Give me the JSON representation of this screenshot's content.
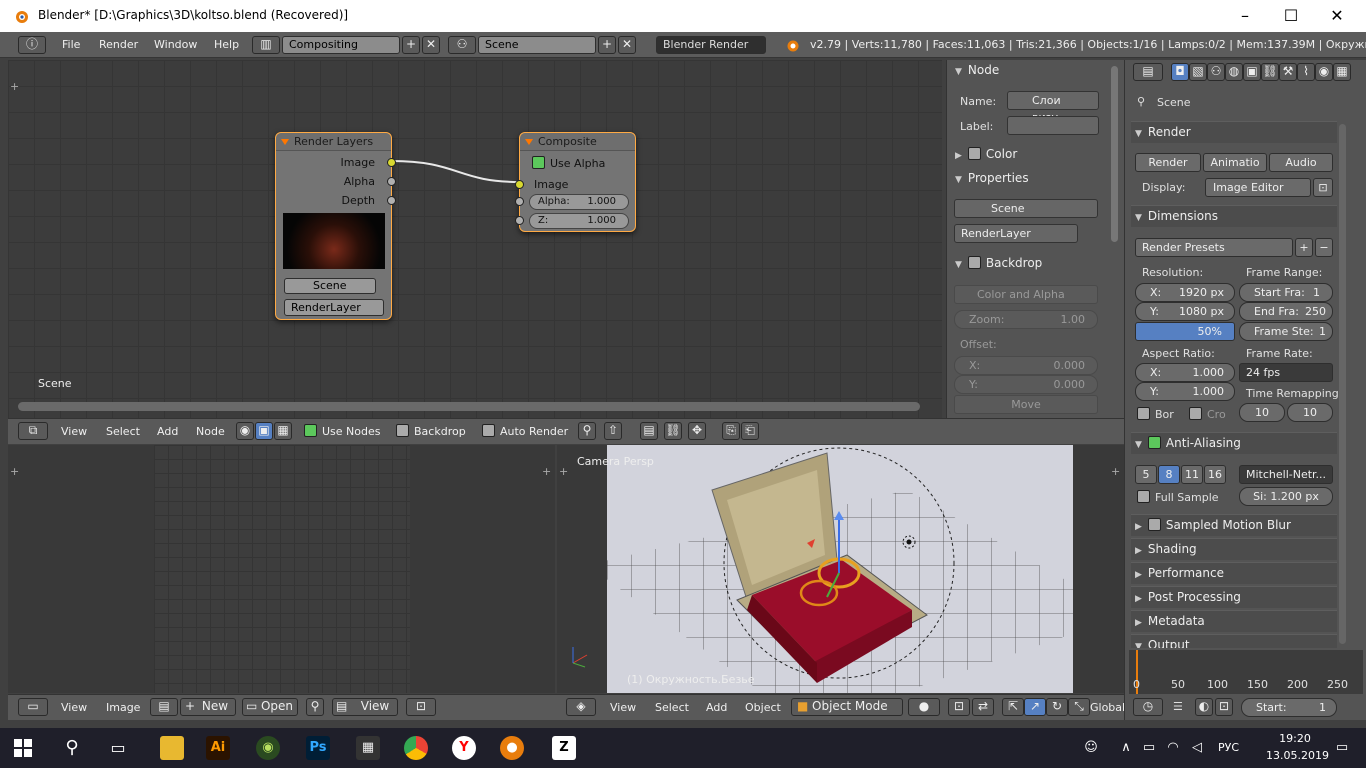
{
  "window": {
    "title": "Blender* [D:\\Graphics\\3D\\koltso.blend (Recovered)]",
    "minimize": "–",
    "maximize": "☐",
    "close": "✕"
  },
  "topbar": {
    "menus": [
      "File",
      "Render",
      "Window",
      "Help"
    ],
    "screen": "Compositing",
    "scene": "Scene",
    "engine": "Blender Render",
    "stats": "v2.79 | Verts:11,780 | Faces:11,063 | Tris:21,366 | Objects:1/16 | Lamps:0/2 | Mem:137.39M | Окружность"
  },
  "node_editor": {
    "render_layers": {
      "title": "Render Layers",
      "outputs": [
        "Image",
        "Alpha",
        "Depth"
      ],
      "scene": "Scene",
      "layer": "RenderLayer"
    },
    "composite": {
      "title": "Composite",
      "use_alpha": "Use Alpha",
      "input": "Image",
      "alpha_label": "Alpha:",
      "alpha_value": "1.000",
      "z_label": "Z:",
      "z_value": "1.000"
    },
    "scene_label": "Scene"
  },
  "node_props": {
    "node_header": "Node",
    "name_label": "Name:",
    "name_value": "Слои визу...",
    "label_label": "Label:",
    "color": "Color",
    "properties": "Properties",
    "scene": "Scene",
    "render_layer": "RenderLayer",
    "backdrop": "Backdrop",
    "color_alpha": "Color and Alpha",
    "zoom_label": "Zoom:",
    "zoom_value": "1.00",
    "offset": "Offset:",
    "x_label": "X:",
    "x_value": "0.000",
    "y_label": "Y:",
    "y_value": "0.000",
    "move": "Move"
  },
  "node_header": {
    "items": [
      "View",
      "Select",
      "Add",
      "Node"
    ],
    "use_nodes": "Use Nodes",
    "backdrop": "Backdrop",
    "auto_render": "Auto Render"
  },
  "viewport": {
    "label": "Camera Persp",
    "object": "(1) Окружность.Безье"
  },
  "bottom_bar": {
    "image_menus": [
      "View",
      "Image"
    ],
    "new": "New",
    "open": "Open",
    "view": "View",
    "vp_menus": [
      "View",
      "Select",
      "Add",
      "Object"
    ],
    "mode": "Object Mode",
    "orientation": "Global"
  },
  "render_props": {
    "scene": "Scene",
    "render": "Render",
    "btn_render": "Render",
    "btn_anim": "Animatio",
    "btn_audio": "Audio",
    "display_label": "Display:",
    "display_value": "Image Editor",
    "dimensions": "Dimensions",
    "presets": "Render Presets",
    "resolution": "Resolution:",
    "res_x": "X:",
    "res_x_v": "1920 px",
    "res_y": "Y:",
    "res_y_v": "1080 px",
    "res_pct": "50%",
    "frame_range": "Frame Range:",
    "start": "Start Fra:",
    "start_v": "1",
    "end": "End Fra:",
    "end_v": "250",
    "step": "Frame Ste:",
    "step_v": "1",
    "aspect": "Aspect Ratio:",
    "ax": "X:",
    "ax_v": "1.000",
    "ay": "Y:",
    "ay_v": "1.000",
    "frame_rate": "Frame Rate:",
    "fps": "24 fps",
    "time_remap": "Time Remapping:",
    "tr_a": "10",
    "tr_b": "10",
    "bor": "Bor",
    "cro": "Cro",
    "aa": "Anti-Aliasing",
    "aa_levels": [
      "5",
      "8",
      "11",
      "16"
    ],
    "aa_filter": "Mitchell-Netr...",
    "full_sample": "Full Sample",
    "size": "Si: 1.200 px",
    "sections": [
      "Sampled Motion Blur",
      "Shading",
      "Performance",
      "Post Processing",
      "Metadata",
      "Output"
    ],
    "timeline_ticks": [
      "0",
      "50",
      "100",
      "150",
      "200",
      "250"
    ],
    "start_label": "Start:",
    "start_val": "1"
  },
  "taskbar": {
    "lang": "РУС",
    "time": "19:20",
    "date": "13.05.2019"
  },
  "colors": {
    "accent": "#5680c2",
    "node_border": "#ffaa44",
    "socket_yellow": "#d8d830"
  }
}
